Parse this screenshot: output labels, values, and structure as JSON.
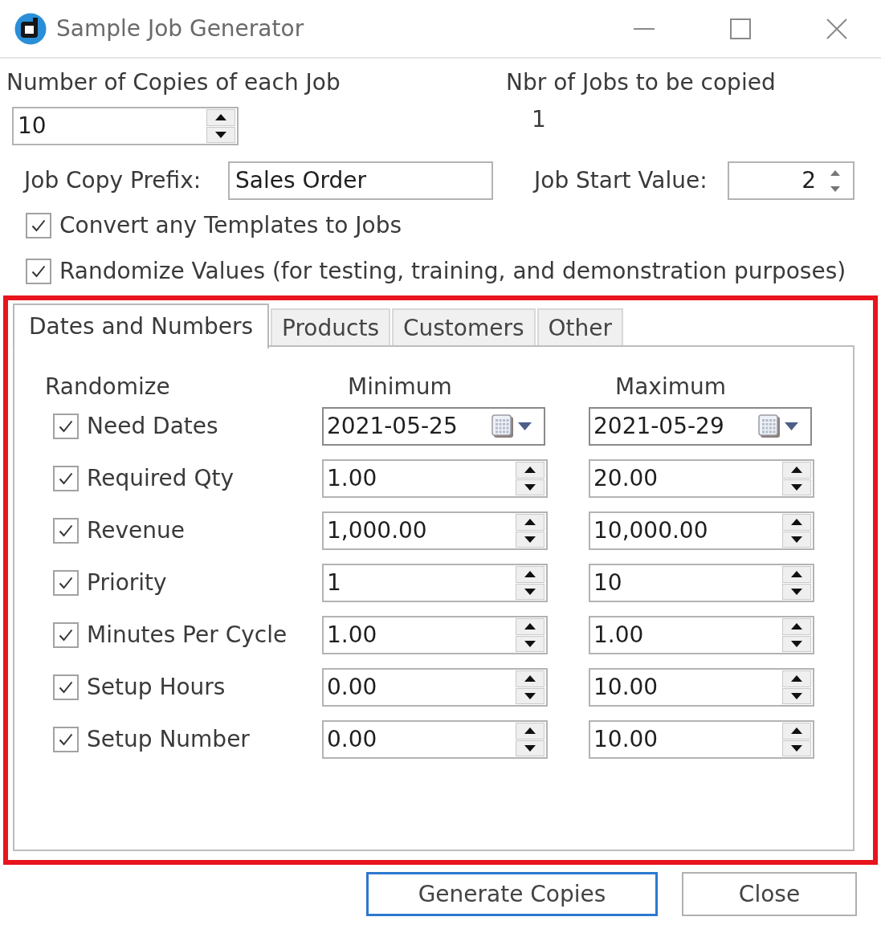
{
  "window": {
    "title": "Sample Job Generator"
  },
  "copies": {
    "label": "Number of Copies of each Job",
    "value": "10"
  },
  "job_count": {
    "label": "Nbr of Jobs to be copied",
    "value": "1"
  },
  "prefix": {
    "label": "Job Copy Prefix:",
    "value": "Sales Order"
  },
  "start_value": {
    "label": "Job Start Value:",
    "value": "2"
  },
  "options": [
    {
      "label": "Convert any Templates to Jobs",
      "checked": true
    },
    {
      "label": "Randomize Values (for testing, training, and demonstration purposes)",
      "checked": true
    }
  ],
  "tab_control": {
    "highlighted": true,
    "tabs": [
      {
        "label": "Dates and Numbers",
        "selected": true
      },
      {
        "label": "Products",
        "selected": false
      },
      {
        "label": "Customers",
        "selected": false
      },
      {
        "label": "Other",
        "selected": false
      }
    ],
    "randomize": {
      "columns": [
        "Randomize",
        "Minimum",
        "Maximum"
      ],
      "rows": [
        {
          "label": "Need Dates",
          "checked": true,
          "kind": "date",
          "minimum": "2021-05-25",
          "maximum": "2021-05-29"
        },
        {
          "label": "Required Qty",
          "checked": true,
          "kind": "number",
          "minimum": "1.00",
          "maximum": "20.00"
        },
        {
          "label": "Revenue",
          "checked": true,
          "kind": "number",
          "minimum": "1,000.00",
          "maximum": "10,000.00"
        },
        {
          "label": "Priority",
          "checked": true,
          "kind": "number",
          "minimum": "1",
          "maximum": "10"
        },
        {
          "label": "Minutes Per Cycle",
          "checked": true,
          "kind": "number",
          "minimum": "1.00",
          "maximum": "1.00"
        },
        {
          "label": "Setup Hours",
          "checked": true,
          "kind": "number",
          "minimum": "0.00",
          "maximum": "10.00"
        },
        {
          "label": "Setup Number",
          "checked": true,
          "kind": "number",
          "minimum": "0.00",
          "maximum": "10.00"
        }
      ]
    }
  },
  "buttons": [
    {
      "label": "Generate Copies",
      "default": true
    },
    {
      "label": "Close",
      "default": false
    }
  ]
}
